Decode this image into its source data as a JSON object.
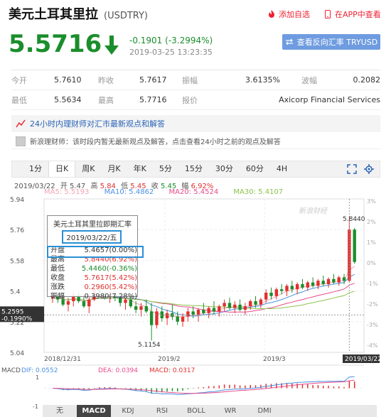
{
  "header": {
    "name": "美元土耳其里拉",
    "symbol": "(USDTRY)",
    "add_watch": "添加自选",
    "app_view": "在APP中查看"
  },
  "quote": {
    "price": "5.5716",
    "change": "-0.1901 (-3.2994%)",
    "timestamp": "2019-03-25 13:23:35",
    "reverse_button": "查看反向汇率 TRYUSD",
    "rows": [
      {
        "l1": "今开",
        "v1": "5.7610",
        "l2": "昨收",
        "v2": "5.7617",
        "l3": "振幅",
        "v3": "3.6135%",
        "l4": "波幅",
        "v4": "0.2082"
      },
      {
        "l1": "最低",
        "v1": "5.5634",
        "l2": "最高",
        "v2": "5.7716",
        "l3": "报价",
        "v3": "",
        "l4": "",
        "v4": "Axicorp Financial Services"
      }
    ]
  },
  "news": {
    "headline": "24小时内理财师对汇市最新观点和解答",
    "body": "新浪理财师：该时段内暂无最新观点及解答，点击查看24小时之前的观点及解答"
  },
  "period_tabs": [
    "1分",
    "日K",
    "周K",
    "月K",
    "年K",
    "5分",
    "15分",
    "30分",
    "60分",
    "4H"
  ],
  "active_period": "日K",
  "ma_info": {
    "date_line": "2019/03/22",
    "open_lbl": "开",
    "open": "5.47",
    "high_lbl": "高",
    "high": "5.84",
    "low_lbl": "低",
    "low": "5.45",
    "chg_lbl": "幅",
    "chg": "6.92%",
    "ma5": "MA5: 5.5193",
    "ma10": "MA10: 5.4862",
    "ma20": "MA20: 5.4524",
    "ma30": "MA30: 5.4107"
  },
  "tooltip": {
    "title": "美元土耳其里拉即期汇率",
    "date": "2019/03/22/五",
    "rows": [
      {
        "k": "开盘",
        "v": "5.4657(0.00%)"
      },
      {
        "k": "最高",
        "v": "5.8440(6.92%)"
      },
      {
        "k": "最低",
        "v": "5.4460(-0.36%)"
      },
      {
        "k": "收盘",
        "v": "5.7617(5.42%)"
      },
      {
        "k": "涨跌",
        "v": "0.2960(5.42%)"
      },
      {
        "k": "振幅",
        "v": "0.3980(7.28%)"
      }
    ]
  },
  "chart_labels": {
    "y_ticks": [
      "5.94",
      "5.76",
      "5.58",
      "5.4",
      "5.22",
      "5.04"
    ],
    "right_pct": [
      "3%",
      "2%",
      "1%",
      "0%",
      "-1%",
      "-2%",
      "-3%",
      "-4%"
    ],
    "x_ticks": [
      "2018/12/31",
      "2019/2",
      "2019/3",
      "2019/03/22"
    ],
    "cross_price": "5.2595",
    "cross_pct": "-0.1990%",
    "high_label": "5.8440",
    "low_label": "5.1154",
    "watermark": "新浪财经"
  },
  "macd": {
    "label": "MACD",
    "dif": "DIF: 0.0552",
    "dea": "DEA: 0.0394",
    "macd": "MACD: 0.0317",
    "axis_top": "1",
    "axis_bottom": "-1"
  },
  "indicator_tabs": [
    "无",
    "MACD",
    "KDJ",
    "RSI",
    "BOLL",
    "WR",
    "DMI"
  ],
  "active_indicator": "MACD",
  "colors": {
    "up": "#e0302d",
    "down": "#1b8e2c",
    "ma5": "#f2a3b3",
    "ma10": "#4a90e2",
    "ma20": "#e94a8a",
    "ma30": "#8bc34a"
  },
  "chart_data": {
    "type": "candlestick",
    "candles": [
      [
        5.36,
        5.4,
        5.33,
        5.38
      ],
      [
        5.38,
        5.42,
        5.33,
        5.35
      ],
      [
        5.35,
        5.39,
        5.31,
        5.32
      ],
      [
        5.32,
        5.36,
        5.28,
        5.34
      ],
      [
        5.34,
        5.4,
        5.31,
        5.38
      ],
      [
        5.38,
        5.4,
        5.33,
        5.34
      ],
      [
        5.34,
        5.37,
        5.3,
        5.31
      ],
      [
        5.31,
        5.36,
        5.27,
        5.35
      ],
      [
        5.35,
        5.43,
        5.34,
        5.41
      ],
      [
        5.41,
        5.44,
        5.37,
        5.39
      ],
      [
        5.39,
        5.42,
        5.35,
        5.37
      ],
      [
        5.37,
        5.4,
        5.33,
        5.38
      ],
      [
        5.38,
        5.41,
        5.34,
        5.36
      ],
      [
        5.36,
        5.39,
        5.31,
        5.33
      ],
      [
        5.33,
        5.36,
        5.29,
        5.35
      ],
      [
        5.35,
        5.38,
        5.3,
        5.31
      ],
      [
        5.31,
        5.34,
        5.27,
        5.29
      ],
      [
        5.29,
        5.33,
        5.25,
        5.31
      ],
      [
        5.31,
        5.35,
        5.27,
        5.28
      ],
      [
        5.28,
        5.33,
        5.11,
        5.2
      ],
      [
        5.2,
        5.3,
        5.18,
        5.28
      ],
      [
        5.28,
        5.31,
        5.22,
        5.24
      ],
      [
        5.24,
        5.29,
        5.2,
        5.27
      ],
      [
        5.27,
        5.32,
        5.23,
        5.25
      ],
      [
        5.25,
        5.28,
        5.2,
        5.22
      ],
      [
        5.22,
        5.27,
        5.19,
        5.25
      ],
      [
        5.25,
        5.3,
        5.22,
        5.28
      ],
      [
        5.28,
        5.31,
        5.24,
        5.26
      ],
      [
        5.26,
        5.3,
        5.22,
        5.29
      ],
      [
        5.29,
        5.33,
        5.26,
        5.27
      ],
      [
        5.27,
        5.31,
        5.24,
        5.3
      ],
      [
        5.3,
        5.34,
        5.26,
        5.28
      ],
      [
        5.28,
        5.32,
        5.25,
        5.31
      ],
      [
        5.31,
        5.35,
        5.28,
        5.33
      ],
      [
        5.33,
        5.36,
        5.29,
        5.3
      ],
      [
        5.3,
        5.34,
        5.27,
        5.32
      ],
      [
        5.32,
        5.35,
        5.28,
        5.29
      ],
      [
        5.29,
        5.33,
        5.26,
        5.31
      ],
      [
        5.31,
        5.35,
        5.29,
        5.34
      ],
      [
        5.34,
        5.37,
        5.3,
        5.32
      ],
      [
        5.32,
        5.36,
        5.3,
        5.35
      ],
      [
        5.35,
        5.41,
        5.33,
        5.39
      ],
      [
        5.39,
        5.42,
        5.35,
        5.37
      ],
      [
        5.37,
        5.42,
        5.35,
        5.41
      ],
      [
        5.41,
        5.44,
        5.38,
        5.4
      ],
      [
        5.4,
        5.44,
        5.37,
        5.43
      ],
      [
        5.43,
        5.46,
        5.39,
        5.41
      ],
      [
        5.41,
        5.45,
        5.38,
        5.44
      ],
      [
        5.44,
        5.47,
        5.41,
        5.42
      ],
      [
        5.42,
        5.46,
        5.4,
        5.45
      ],
      [
        5.45,
        5.48,
        5.42,
        5.43
      ],
      [
        5.43,
        5.47,
        5.41,
        5.46
      ],
      [
        5.46,
        5.49,
        5.43,
        5.44
      ],
      [
        5.44,
        5.48,
        5.42,
        5.47
      ],
      [
        5.47,
        5.5,
        5.44,
        5.45
      ],
      [
        5.45,
        5.49,
        5.43,
        5.48
      ],
      [
        5.48,
        5.5,
        5.44,
        5.46
      ],
      [
        5.46,
        5.84,
        5.45,
        5.76
      ],
      [
        5.76,
        5.77,
        5.56,
        5.57
      ]
    ]
  }
}
